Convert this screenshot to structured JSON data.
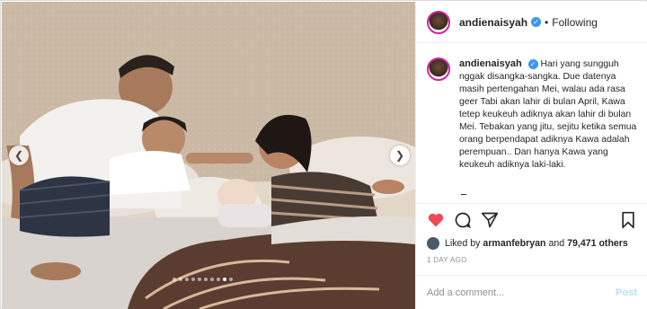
{
  "post": {
    "username": "andienaisyah",
    "verified_icon": "verified-badge-icon",
    "separator": "•",
    "follow_status": "Following",
    "caption": "Hari yang sungguh nggak disangka-sangka. Due datenya masih pertengahan Mei, walau ada rasa geer Tabi akan lahir di bulan April, Kawa tetep keukeuh adiknya akan lahir di bulan Mei. Tebakan yang jitu, sejitu ketika semua orang berpendapat adiknya Kawa adalah perempuan.. Dan hanya Kawa yang keukeuh adiknya laki-laki.",
    "likes_prefix": "Liked by",
    "likes_user": "armanfebryan",
    "likes_and": "and",
    "likes_count": "79,471 others",
    "timestamp": "1 DAY AGO",
    "comment_placeholder": "Add a comment...",
    "post_label": "Post"
  },
  "carousel": {
    "prev_icon": "chevron-left-icon",
    "next_icon": "chevron-right-icon",
    "slide_count": 10,
    "active_slide": 9
  },
  "colors": {
    "like_red": "#ed4956",
    "verified_blue": "#3897f0",
    "post_disabled": "#b2dffc"
  }
}
